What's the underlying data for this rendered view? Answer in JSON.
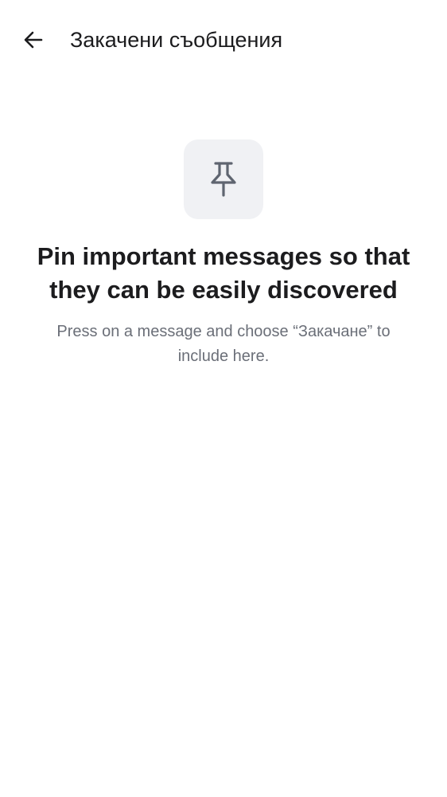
{
  "header": {
    "title": "Закачени съобщения",
    "back_icon": "arrow-left-icon"
  },
  "empty_state": {
    "icon": "pin-icon",
    "heading": "Pin important messages so that they can be easily discovered",
    "hint": "Press on a message and choose “Закачане” to include here."
  },
  "colors": {
    "text_primary": "#1c1c1e",
    "text_secondary": "#6b6f78",
    "icon_tile_bg": "#f0f1f4",
    "icon_color": "#5f6570"
  }
}
